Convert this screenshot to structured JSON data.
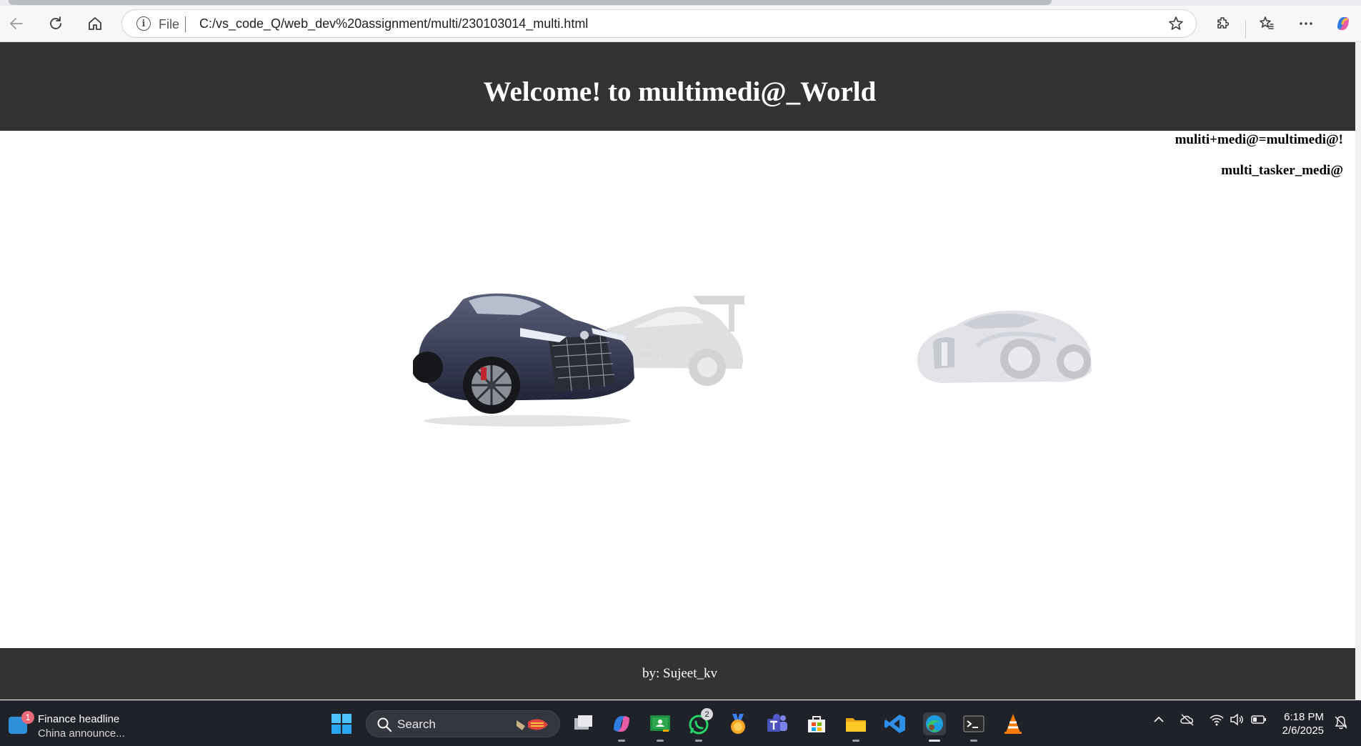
{
  "browser": {
    "scheme_label": "File",
    "url": "C:/vs_code_Q/web_dev%20assignment/multi/230103014_multi.html",
    "icons": [
      "back-icon",
      "refresh-icon",
      "home-icon",
      "info-icon",
      "favorite-star-icon",
      "extensions-icon",
      "favorites-icon",
      "more-icon",
      "copilot-icon"
    ]
  },
  "page": {
    "title": "Welcome! to multimedi@_World",
    "tagline_1": "muliti+medi@=multimedi@!",
    "tagline_2": "multi_tasker_medi@",
    "footer": "by: Sujeet_kv",
    "colors": {
      "header_bg": "#333333",
      "footer_bg": "#333333",
      "text_light": "#ffffff"
    },
    "images": [
      "lexus-sports-car-image",
      "racing-car-faded-image",
      "bugatti-car-faded-image"
    ]
  },
  "taskbar": {
    "widget": {
      "badge": "1",
      "title": "Finance headline",
      "subtitle": "China announce..."
    },
    "search_placeholder": "Search",
    "whatsapp_badge": "2",
    "clock": {
      "time": "6:18 PM",
      "date": "2/6/2025"
    }
  }
}
